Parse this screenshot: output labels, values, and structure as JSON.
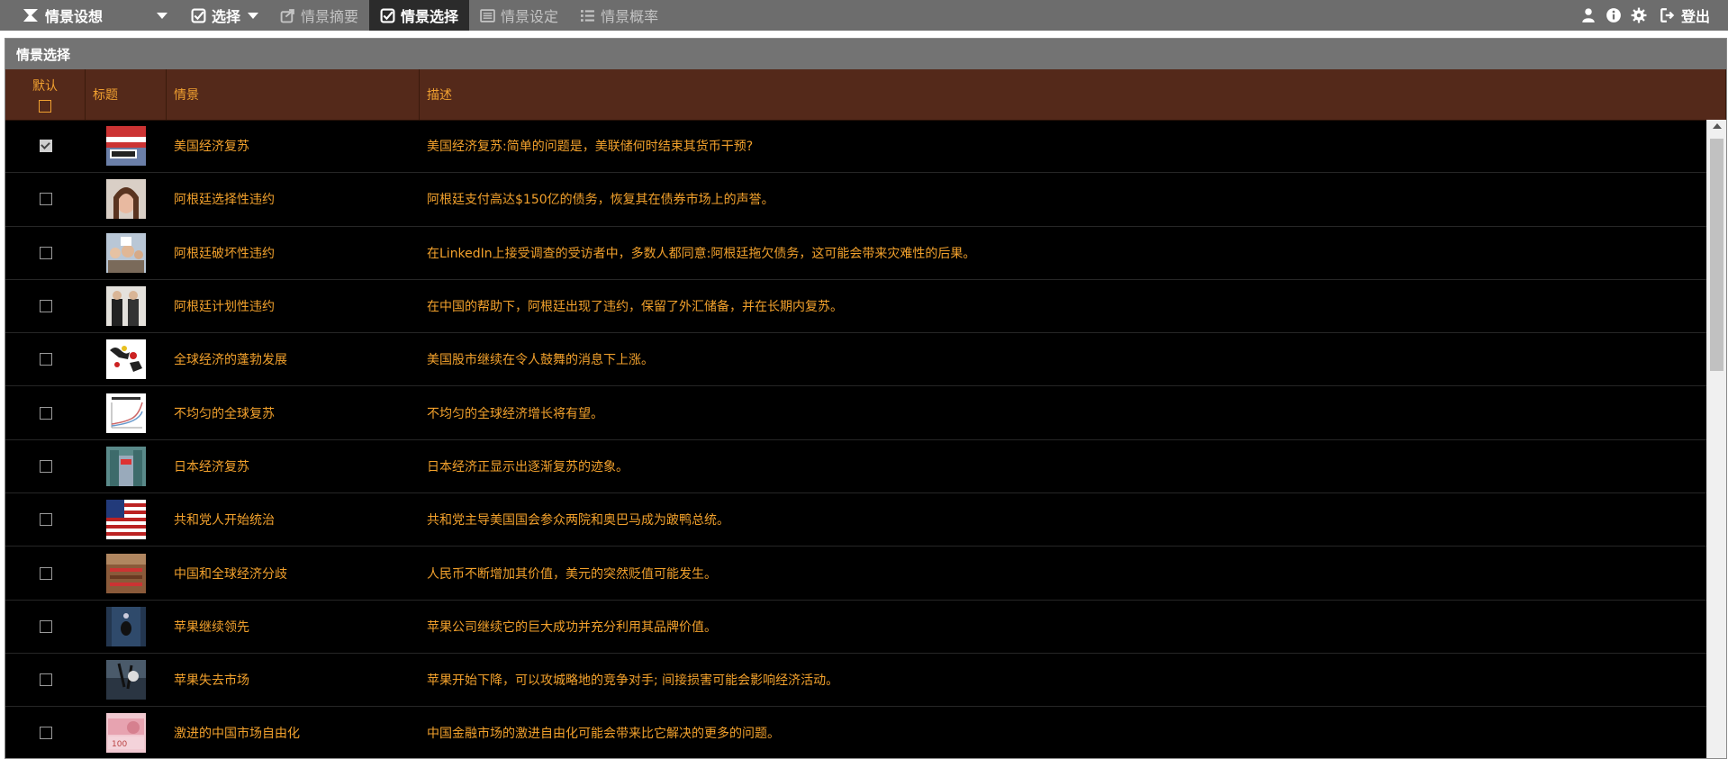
{
  "topbar": {
    "brand": "情景设想",
    "menu": [
      {
        "label": "选择",
        "icon": "check-square-icon",
        "state": "bold",
        "caret": true
      },
      {
        "label": "情景摘要",
        "icon": "share-icon",
        "state": "dim"
      },
      {
        "label": "情景选择",
        "icon": "check-square-icon",
        "state": "active"
      },
      {
        "label": "情景设定",
        "icon": "list-alt-icon",
        "state": "dim"
      },
      {
        "label": "情景概率",
        "icon": "list-icon",
        "state": "dim"
      }
    ],
    "logout": "登出"
  },
  "panel": {
    "title": "情景选择",
    "columns": {
      "default": "默认",
      "title": "标题",
      "scenario": "情景",
      "description": "描述"
    }
  },
  "rows": [
    {
      "checked": true,
      "thumb": "wall-street-sign",
      "scenario": "美国经济复苏",
      "description": "美国经济复苏:简单的问题是，美联储何时结束其货币干预?"
    },
    {
      "checked": false,
      "thumb": "woman-portrait",
      "scenario": "阿根廷选择性违约",
      "description": "阿根廷支付高达$150亿的债务，恢复其在债券市场上的声誉。"
    },
    {
      "checked": false,
      "thumb": "protest-crowd",
      "scenario": "阿根廷破坏性违约",
      "description": "在LinkedIn上接受调查的受访者中，多数人都同意:阿根廷拖欠债务，这可能会带来灾难性的后果。"
    },
    {
      "checked": false,
      "thumb": "two-leaders",
      "scenario": "阿根廷计划性违约",
      "description": "在中国的帮助下，阿根廷出现了违约，保留了外汇储备，并在长期内复苏。"
    },
    {
      "checked": false,
      "thumb": "world-map",
      "scenario": "全球经济的蓬勃发展",
      "description": "美国股市继续在令人鼓舞的消息下上涨。"
    },
    {
      "checked": false,
      "thumb": "line-chart",
      "scenario": "不均匀的全球复苏",
      "description": "不均匀的全球经济增长将有望。"
    },
    {
      "checked": false,
      "thumb": "japan-street",
      "scenario": "日本经济复苏",
      "description": "日本经济正显示出逐渐复苏的迹象。"
    },
    {
      "checked": false,
      "thumb": "us-flag",
      "scenario": "共和党人开始统治",
      "description": "共和党主导美国国会参众两院和奥巴马成为跛鸭总统。"
    },
    {
      "checked": false,
      "thumb": "congress-hall",
      "scenario": "中国和全球经济分歧",
      "description": "人民币不断增加其价值，美元的突然贬值可能发生。"
    },
    {
      "checked": false,
      "thumb": "apple-store",
      "scenario": "苹果继续领先",
      "description": "苹果公司继续它的巨大成功并充分利用其品牌价值。"
    },
    {
      "checked": false,
      "thumb": "apple-logo-street",
      "scenario": "苹果失去市场",
      "description": "苹果开始下降，可以攻城略地的竞争对手; 间接损害可能会影响经济活动。"
    },
    {
      "checked": false,
      "thumb": "yuan-banknotes",
      "scenario": "激进的中国市场自由化",
      "description": "中国金融市场的激进自由化可能会带来比它解决的更多的问题。"
    }
  ]
}
